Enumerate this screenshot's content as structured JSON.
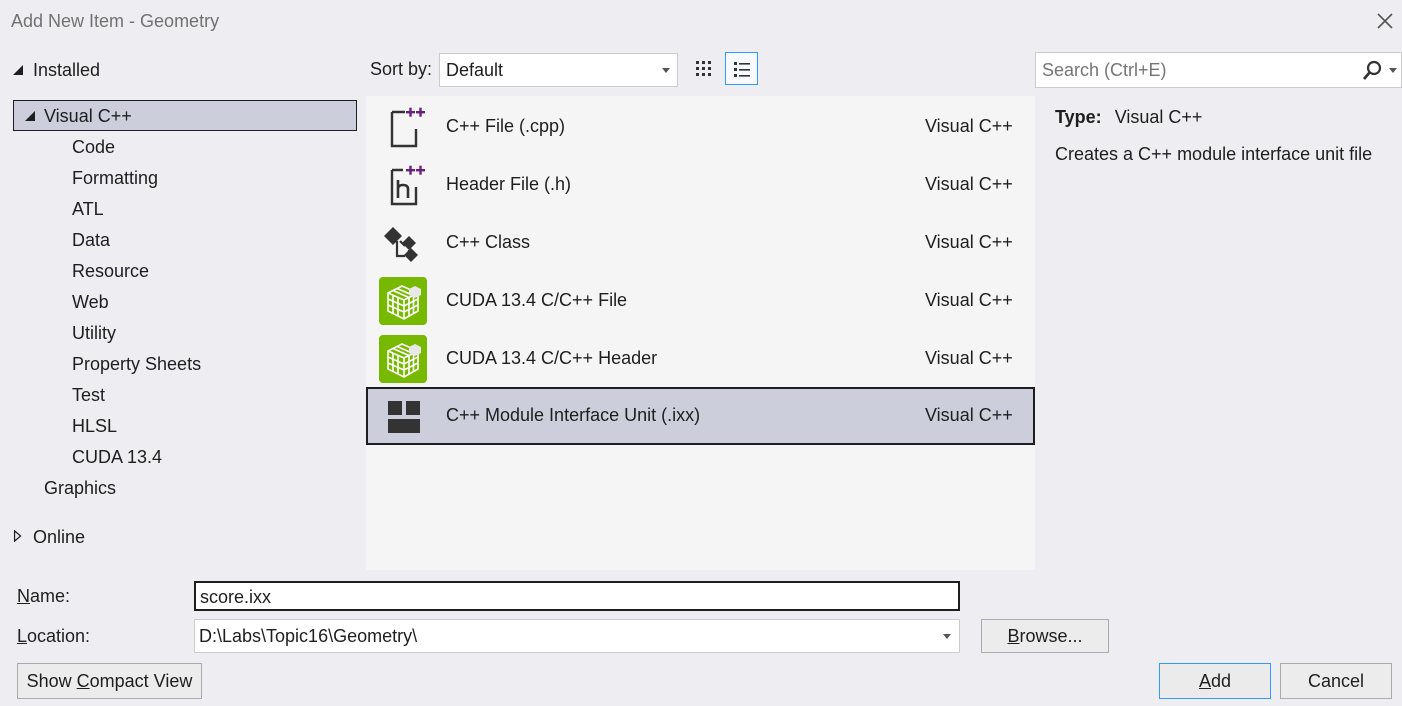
{
  "window": {
    "title": "Add New Item - Geometry"
  },
  "tree": {
    "installed": "Installed",
    "visual_cpp": "Visual C++",
    "children": [
      "Code",
      "Formatting",
      "ATL",
      "Data",
      "Resource",
      "Web",
      "Utility",
      "Property Sheets",
      "Test",
      "HLSL",
      "CUDA 13.4"
    ],
    "graphics": "Graphics",
    "online": "Online"
  },
  "sort": {
    "label": "Sort by:",
    "value": "Default"
  },
  "search": {
    "placeholder": "Search (Ctrl+E)"
  },
  "items": [
    {
      "name": "C++ File (.cpp)",
      "lang": "Visual C++",
      "icon": "cpp-file-icon"
    },
    {
      "name": "Header File (.h)",
      "lang": "Visual C++",
      "icon": "header-file-icon"
    },
    {
      "name": "C++ Class",
      "lang": "Visual C++",
      "icon": "cpp-class-icon"
    },
    {
      "name": "CUDA 13.4 C/C++ File",
      "lang": "Visual C++",
      "icon": "cuda-file-icon"
    },
    {
      "name": "CUDA 13.4 C/C++ Header",
      "lang": "Visual C++",
      "icon": "cuda-header-icon"
    },
    {
      "name": "C++ Module Interface Unit (.ixx)",
      "lang": "Visual C++",
      "icon": "module-interface-icon"
    }
  ],
  "details": {
    "type_label": "Type:",
    "type_value": "Visual C++",
    "description": "Creates a C++ module interface unit file"
  },
  "form": {
    "name_label_u": "N",
    "name_label_rest": "ame:",
    "name_value": "score.ixx",
    "location_label_u": "L",
    "location_label_rest": "ocation:",
    "location_value": "D:\\Labs\\Topic16\\Geometry\\"
  },
  "buttons": {
    "browse_u": "B",
    "browse_rest": "rowse...",
    "compact_pre": "Show ",
    "compact_u": "C",
    "compact_rest": "ompact View",
    "add_u": "A",
    "add_rest": "dd",
    "cancel": "Cancel"
  },
  "colors": {
    "accent": "#3399ff",
    "selection": "#cccedb",
    "cuda_green": "#76b900",
    "plus_purple": "#68217a"
  }
}
